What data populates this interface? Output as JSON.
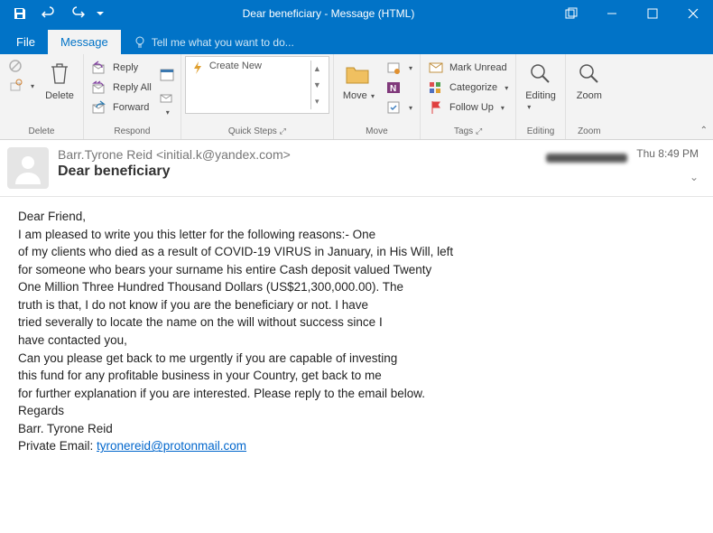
{
  "window": {
    "title": "Dear beneficiary - Message (HTML)"
  },
  "tabs": {
    "file": "File",
    "message": "Message",
    "tell_me": "Tell me what you want to do..."
  },
  "ribbon": {
    "delete": {
      "label": "Delete",
      "ignore": "",
      "junk": "",
      "group": "Delete"
    },
    "respond": {
      "reply": "Reply",
      "reply_all": "Reply All",
      "forward": "Forward",
      "group": "Respond"
    },
    "quick_steps": {
      "create_new": "Create New",
      "group": "Quick Steps"
    },
    "move": {
      "move": "Move",
      "group": "Move"
    },
    "tags": {
      "mark_unread": "Mark Unread",
      "categorize": "Categorize",
      "follow_up": "Follow Up",
      "group": "Tags"
    },
    "editing": {
      "label": "Editing",
      "group": "Editing"
    },
    "zoom": {
      "label": "Zoom",
      "group": "Zoom"
    }
  },
  "message": {
    "from": "Barr.Tyrone Reid <initial.k@yandex.com>",
    "subject": "Dear beneficiary",
    "date": "Thu 8:49 PM",
    "body_lines": [
      "Dear Friend,",
      "I am pleased to write you this letter for the following reasons:- One",
      "of my clients who died as a result of COVID-19 VIRUS in January, in His Will, left",
      "for someone who bears your surname his entire Cash deposit valued Twenty",
      "One Million Three Hundred Thousand Dollars (US$21,300,000.00). The",
      "truth is that, I do not know if you are the beneficiary or not. I have",
      "tried severally to locate the name on the will without success since I",
      "have contacted you,",
      "Can you please get back to me urgently if you are capable of investing",
      "this fund for any profitable business in your Country, get back to me",
      "for further explanation if you are interested. Please reply to the email below.",
      "Regards",
      "Barr. Tyrone Reid"
    ],
    "private_email_label": "Private Email: ",
    "private_email": "tyronereid@protonmail.com"
  }
}
